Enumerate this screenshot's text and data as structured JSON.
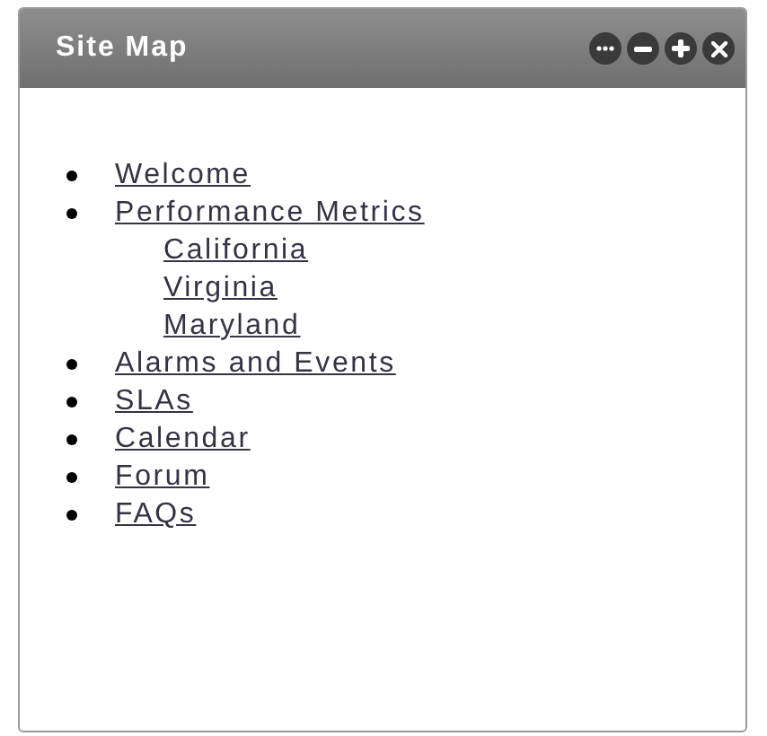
{
  "panel": {
    "title": "Site Map"
  },
  "items": [
    {
      "label": "Welcome"
    },
    {
      "label": "Performance Metrics",
      "children": [
        {
          "label": "California"
        },
        {
          "label": "Virginia"
        },
        {
          "label": "Maryland"
        }
      ]
    },
    {
      "label": "Alarms and Events"
    },
    {
      "label": "SLAs"
    },
    {
      "label": "Calendar"
    },
    {
      "label": "Forum"
    },
    {
      "label": "FAQs"
    }
  ]
}
